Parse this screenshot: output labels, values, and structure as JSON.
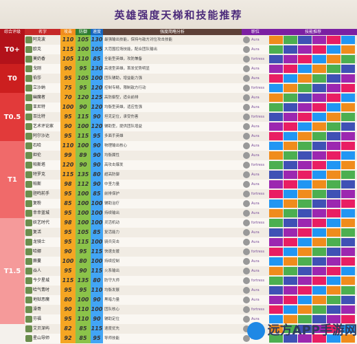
{
  "title": "英雄强度天梯和技能推荐",
  "header": [
    "综合评级",
    "名字",
    "攻击",
    "防御",
    "速度",
    "强度简略分析",
    "职位",
    "技能推荐"
  ],
  "tiers": [
    {
      "label": "T0+",
      "rows": 3,
      "color": "#b3121a"
    },
    {
      "label": "T0",
      "rows": 3,
      "color": "#cc1f1f"
    },
    {
      "label": "T0.5",
      "rows": 5,
      "color": "#e23a3a"
    },
    {
      "label": "T1",
      "rows": 8,
      "color": "#f06a6a"
    },
    {
      "label": "T1.5",
      "rows": 11,
      "color": "#f59a9a"
    }
  ],
  "rows": [
    {
      "name": "阿克波",
      "v": [
        "110",
        "105",
        "130"
      ],
      "desc": "最强输出技能，保持与敌方对位攻击技能",
      "pos": "Aura"
    },
    {
      "name": "欧克",
      "v": [
        "115",
        "100",
        "105"
      ],
      "desc": "大范围控场技能，配合团队输出",
      "pos": "Aura"
    },
    {
      "name": "莫奶香",
      "v": [
        "105",
        "110",
        "85"
      ],
      "desc": "全能型英雄，攻防兼备",
      "pos": "fortress"
    },
    {
      "name": "戈刚",
      "v": [
        "90",
        "95",
        "130"
      ],
      "desc": "高速型英雄，首发优势明显",
      "pos": "Aura"
    },
    {
      "name": "伯莎",
      "v": [
        "95",
        "105",
        "100"
      ],
      "desc": "团队辅助，增益能力强",
      "pos": "Aura"
    },
    {
      "name": "立沙纳",
      "v": [
        "75",
        "95",
        "120"
      ],
      "desc": "控制专精，限制敌方行动",
      "pos": "fortress"
    },
    {
      "name": "幽魔者",
      "v": [
        "70",
        "120",
        "125"
      ],
      "desc": "高防御型，适合前排",
      "pos": "Aura"
    },
    {
      "name": "亚尼特",
      "v": [
        "100",
        "90",
        "120"
      ],
      "desc": "均衡型英雄，适应性强",
      "pos": "Aura"
    },
    {
      "name": "百比特",
      "v": [
        "95",
        "115",
        "90"
      ],
      "desc": "坦克定位，承受伤害",
      "pos": "fortress"
    },
    {
      "name": "艺术评论家",
      "v": [
        "90",
        "100",
        "120"
      ],
      "desc": "辅助型，提供团队增益",
      "pos": "Aura"
    },
    {
      "name": "阿尔沙达",
      "v": [
        "95",
        "115",
        "95"
      ],
      "desc": "多面手英雄",
      "pos": "Aura"
    },
    {
      "name": "石哈",
      "v": [
        "110",
        "100",
        "90"
      ],
      "desc": "物理输出核心",
      "pos": "Aura"
    },
    {
      "name": "妲伦",
      "v": [
        "99",
        "89",
        "90"
      ],
      "desc": "均衡属性",
      "pos": "Aura"
    },
    {
      "name": "帕斯塔",
      "v": [
        "120",
        "90",
        "90"
      ],
      "desc": "高攻击爆发",
      "pos": "fortress"
    },
    {
      "name": "特罗克",
      "v": [
        "115",
        "135",
        "80"
      ],
      "desc": "超高防御",
      "pos": "Aura"
    },
    {
      "name": "帕斯",
      "v": [
        "98",
        "112",
        "90"
      ],
      "desc": "中坚力量",
      "pos": "Aura"
    },
    {
      "name": "胆鸣前手",
      "v": [
        "95",
        "100",
        "85"
      ],
      "desc": "前排保护",
      "pos": "fortress"
    },
    {
      "name": "复粉",
      "v": [
        "85",
        "100",
        "100"
      ],
      "desc": "辅助治疗",
      "pos": "Aura"
    },
    {
      "name": "幸幸蓝城",
      "v": [
        "95",
        "100",
        "100"
      ],
      "desc": "持续输出",
      "pos": "Aura"
    },
    {
      "name": "妖艺时代",
      "v": [
        "98",
        "100",
        "100"
      ],
      "desc": "灵活机动",
      "pos": "fortress"
    },
    {
      "name": "复活",
      "v": [
        "95",
        "105",
        "85"
      ],
      "desc": "复活能力",
      "pos": "Aura"
    },
    {
      "name": "龙骑士",
      "v": [
        "95",
        "115",
        "100"
      ],
      "desc": "骑兵突击",
      "pos": "Aura"
    },
    {
      "name": "哈娜",
      "v": [
        "90",
        "95",
        "115"
      ],
      "desc": "快速支援",
      "pos": "fortress"
    },
    {
      "name": "蕨蔓",
      "v": [
        "100",
        "80",
        "100"
      ],
      "desc": "持续控制",
      "pos": "Aura"
    },
    {
      "name": "焱人",
      "v": [
        "95",
        "90",
        "115"
      ],
      "desc": "火系输出",
      "pos": "Aura"
    },
    {
      "name": "今夕星城",
      "v": [
        "115",
        "135",
        "80"
      ],
      "desc": "防守大师",
      "pos": "fortress"
    },
    {
      "name": "哈气青时",
      "v": [
        "95",
        "95",
        "110"
      ],
      "desc": "均衡发展",
      "pos": "Aura"
    },
    {
      "name": "地狱恶魔",
      "v": [
        "80",
        "100",
        "90"
      ],
      "desc": "黑暗力量",
      "pos": "Aura"
    },
    {
      "name": "澡哥",
      "v": [
        "90",
        "110",
        "100"
      ],
      "desc": "团队核心",
      "pos": "fortress"
    },
    {
      "name": "芬福",
      "v": [
        "95",
        "110",
        "90"
      ],
      "desc": "辅助定位",
      "pos": "Aura"
    },
    {
      "name": "艾贝深屿",
      "v": [
        "82",
        "85",
        "115"
      ],
      "desc": "速度优先",
      "pos": "Aura"
    },
    {
      "name": "星山导师",
      "v": [
        "92",
        "85",
        "95"
      ],
      "desc": "导师技能",
      "pos": "Aura"
    }
  ],
  "skill_colors": [
    "#f08c1c",
    "#4caf50",
    "#3f51b5",
    "#9c27b0",
    "#e91e63",
    "#2196f3"
  ],
  "watermark": "远方APP手游网"
}
